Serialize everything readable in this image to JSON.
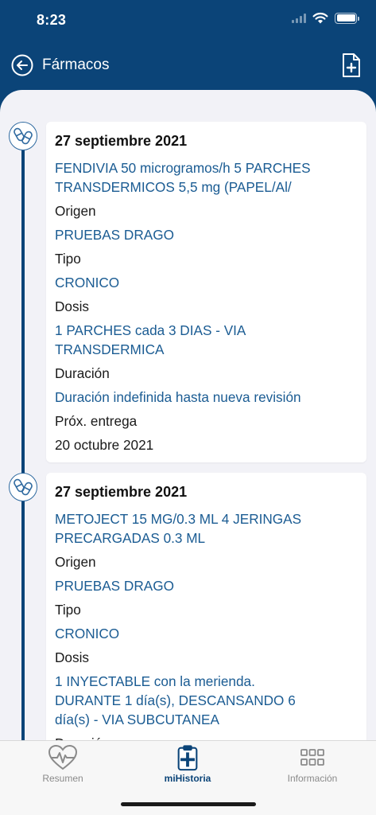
{
  "status_bar": {
    "time": "8:23",
    "battery_level": 1.0
  },
  "nav": {
    "title": "Fármacos"
  },
  "entries": [
    {
      "date": "27 septiembre 2021",
      "drug_line1": "FENDIVIA 50 microgramos/h 5 PARCHES",
      "drug_line2": "TRANSDERMICOS 5,5 mg (PAPEL/Al/",
      "origen_label": "Origen",
      "origen": "PRUEBAS DRAGO",
      "tipo_label": "Tipo",
      "tipo": "CRONICO",
      "dosis_label": "Dosis",
      "dosis_line1": "1 PARCHES cada 3 DIAS -  VIA",
      "dosis_line2": "TRANSDERMICA",
      "duracion_label": "Duración",
      "duracion": "Duración indefinida hasta nueva revisión",
      "entrega_label": "Próx. entrega",
      "entrega": "20 octubre 2021"
    },
    {
      "date": "27 septiembre 2021",
      "drug_line1": "METOJECT 15 MG/0.3 ML 4 JERINGAS",
      "drug_line2": "PRECARGADAS 0.3 ML",
      "origen_label": "Origen",
      "origen": "PRUEBAS DRAGO",
      "tipo_label": "Tipo",
      "tipo": "CRONICO",
      "dosis_label": "Dosis",
      "dosis_line1": "1 INYECTABLE con la merienda.",
      "dosis_line2": "DURANTE 1 día(s), DESCANSANDO 6",
      "dosis_line3": "día(s) -  VIA SUBCUTANEA",
      "duracion_label": "Duración"
    }
  ],
  "tabs": [
    {
      "label": "Resumen",
      "icon": "heart-pulse-icon"
    },
    {
      "label": "miHistoria",
      "icon": "clipboard-plus-icon",
      "active": true
    },
    {
      "label": "Información",
      "icon": "grid-icon"
    }
  ],
  "colors": {
    "primary": "#0b4478",
    "link": "#1b5c93",
    "background": "#f2f2f7",
    "tab_inactive": "#8a8a8a"
  }
}
